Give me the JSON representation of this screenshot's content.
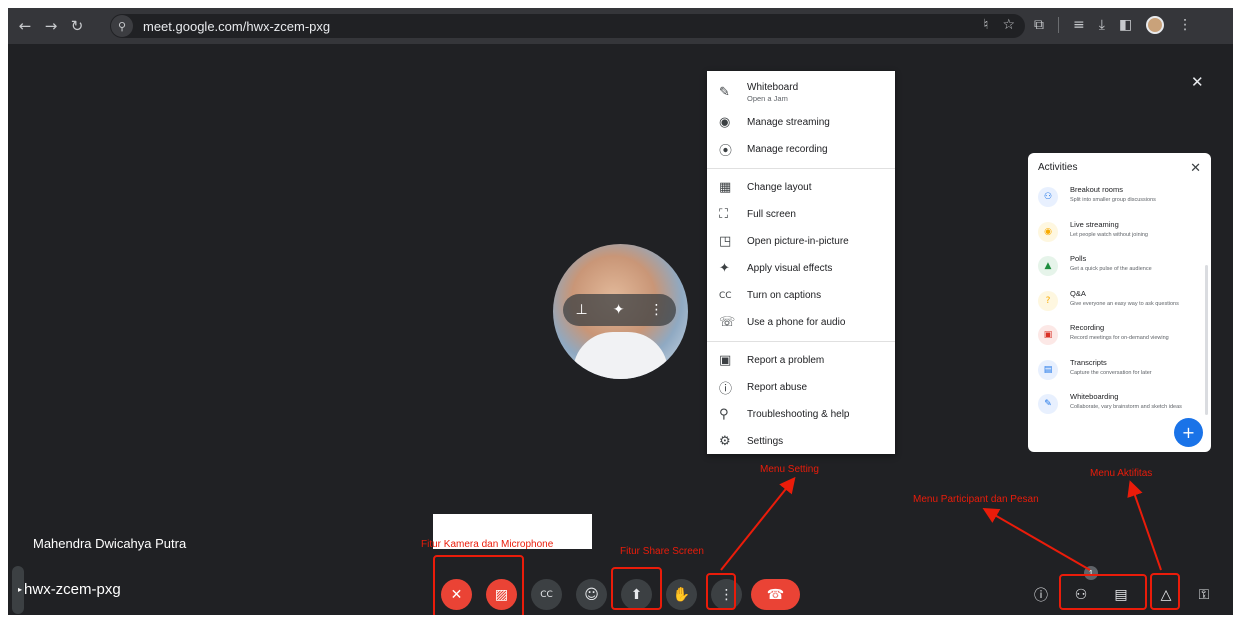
{
  "browser": {
    "url": "meet.google.com/hwx-zcem-pxg",
    "nav": [
      "back-icon",
      "forward-icon",
      "reload-icon"
    ]
  },
  "meeting": {
    "participant_name": "Mahendra Dwicahya Putra",
    "meeting_code": "hwx-zcem-pxg",
    "participant_count_badge": "1"
  },
  "options_menu": {
    "items": [
      {
        "label": "Whiteboard",
        "sub": "Open a Jam",
        "icon": "pen-icon"
      },
      {
        "label": "Manage streaming",
        "icon": "broadcast-icon"
      },
      {
        "label": "Manage recording",
        "icon": "record-icon"
      },
      {
        "label": "Change layout",
        "icon": "layout-icon"
      },
      {
        "label": "Full screen",
        "icon": "fullscreen-icon"
      },
      {
        "label": "Open picture-in-picture",
        "icon": "pip-icon"
      },
      {
        "label": "Apply visual effects",
        "icon": "sparkle-icon"
      },
      {
        "label": "Turn on captions",
        "icon": "captions-icon"
      },
      {
        "label": "Use a phone for audio",
        "icon": "phone-icon"
      },
      {
        "label": "Report a problem",
        "icon": "report-icon"
      },
      {
        "label": "Report abuse",
        "icon": "warning-icon"
      },
      {
        "label": "Troubleshooting & help",
        "icon": "troubleshoot-icon"
      },
      {
        "label": "Settings",
        "icon": "gear-icon"
      }
    ]
  },
  "activities": {
    "title": "Activities",
    "items": [
      {
        "name": "Breakout rooms",
        "desc": "Split into smaller group discussions",
        "color": "#e8f0fe",
        "fg": "#1a73e8"
      },
      {
        "name": "Live streaming",
        "desc": "Let people watch without joining",
        "color": "#fef7e0",
        "fg": "#f9ab00"
      },
      {
        "name": "Polls",
        "desc": "Get a quick pulse of the audience",
        "color": "#e6f4ea",
        "fg": "#1e8e3e"
      },
      {
        "name": "Q&A",
        "desc": "Give everyone an easy way to ask questions",
        "color": "#fef7e0",
        "fg": "#f9ab00"
      },
      {
        "name": "Recording",
        "desc": "Record meetings for on-demand viewing",
        "color": "#fce8e6",
        "fg": "#d93025"
      },
      {
        "name": "Transcripts",
        "desc": "Capture the conversation for later",
        "color": "#e8f0fe",
        "fg": "#1a73e8"
      },
      {
        "name": "Whiteboarding",
        "desc": "Collaborate, vary brainstorm and sketch ideas",
        "color": "#e8f0fe",
        "fg": "#1a73e8"
      }
    ]
  },
  "annotations": {
    "menu_setting": "Menu Setting",
    "menu_aktifitas": "Menu Aktifitas",
    "menu_participant": "Menu Participant dan Pesan",
    "fitur_kamera": "Fitur Kamera dan Microphone",
    "fitur_share": "Fitur Share Screen"
  },
  "colors": {
    "annotation_red": "#ea1c0a",
    "meet_bg": "#202124",
    "end_call_red": "#ea4335",
    "fab_blue": "#1a73e8"
  }
}
